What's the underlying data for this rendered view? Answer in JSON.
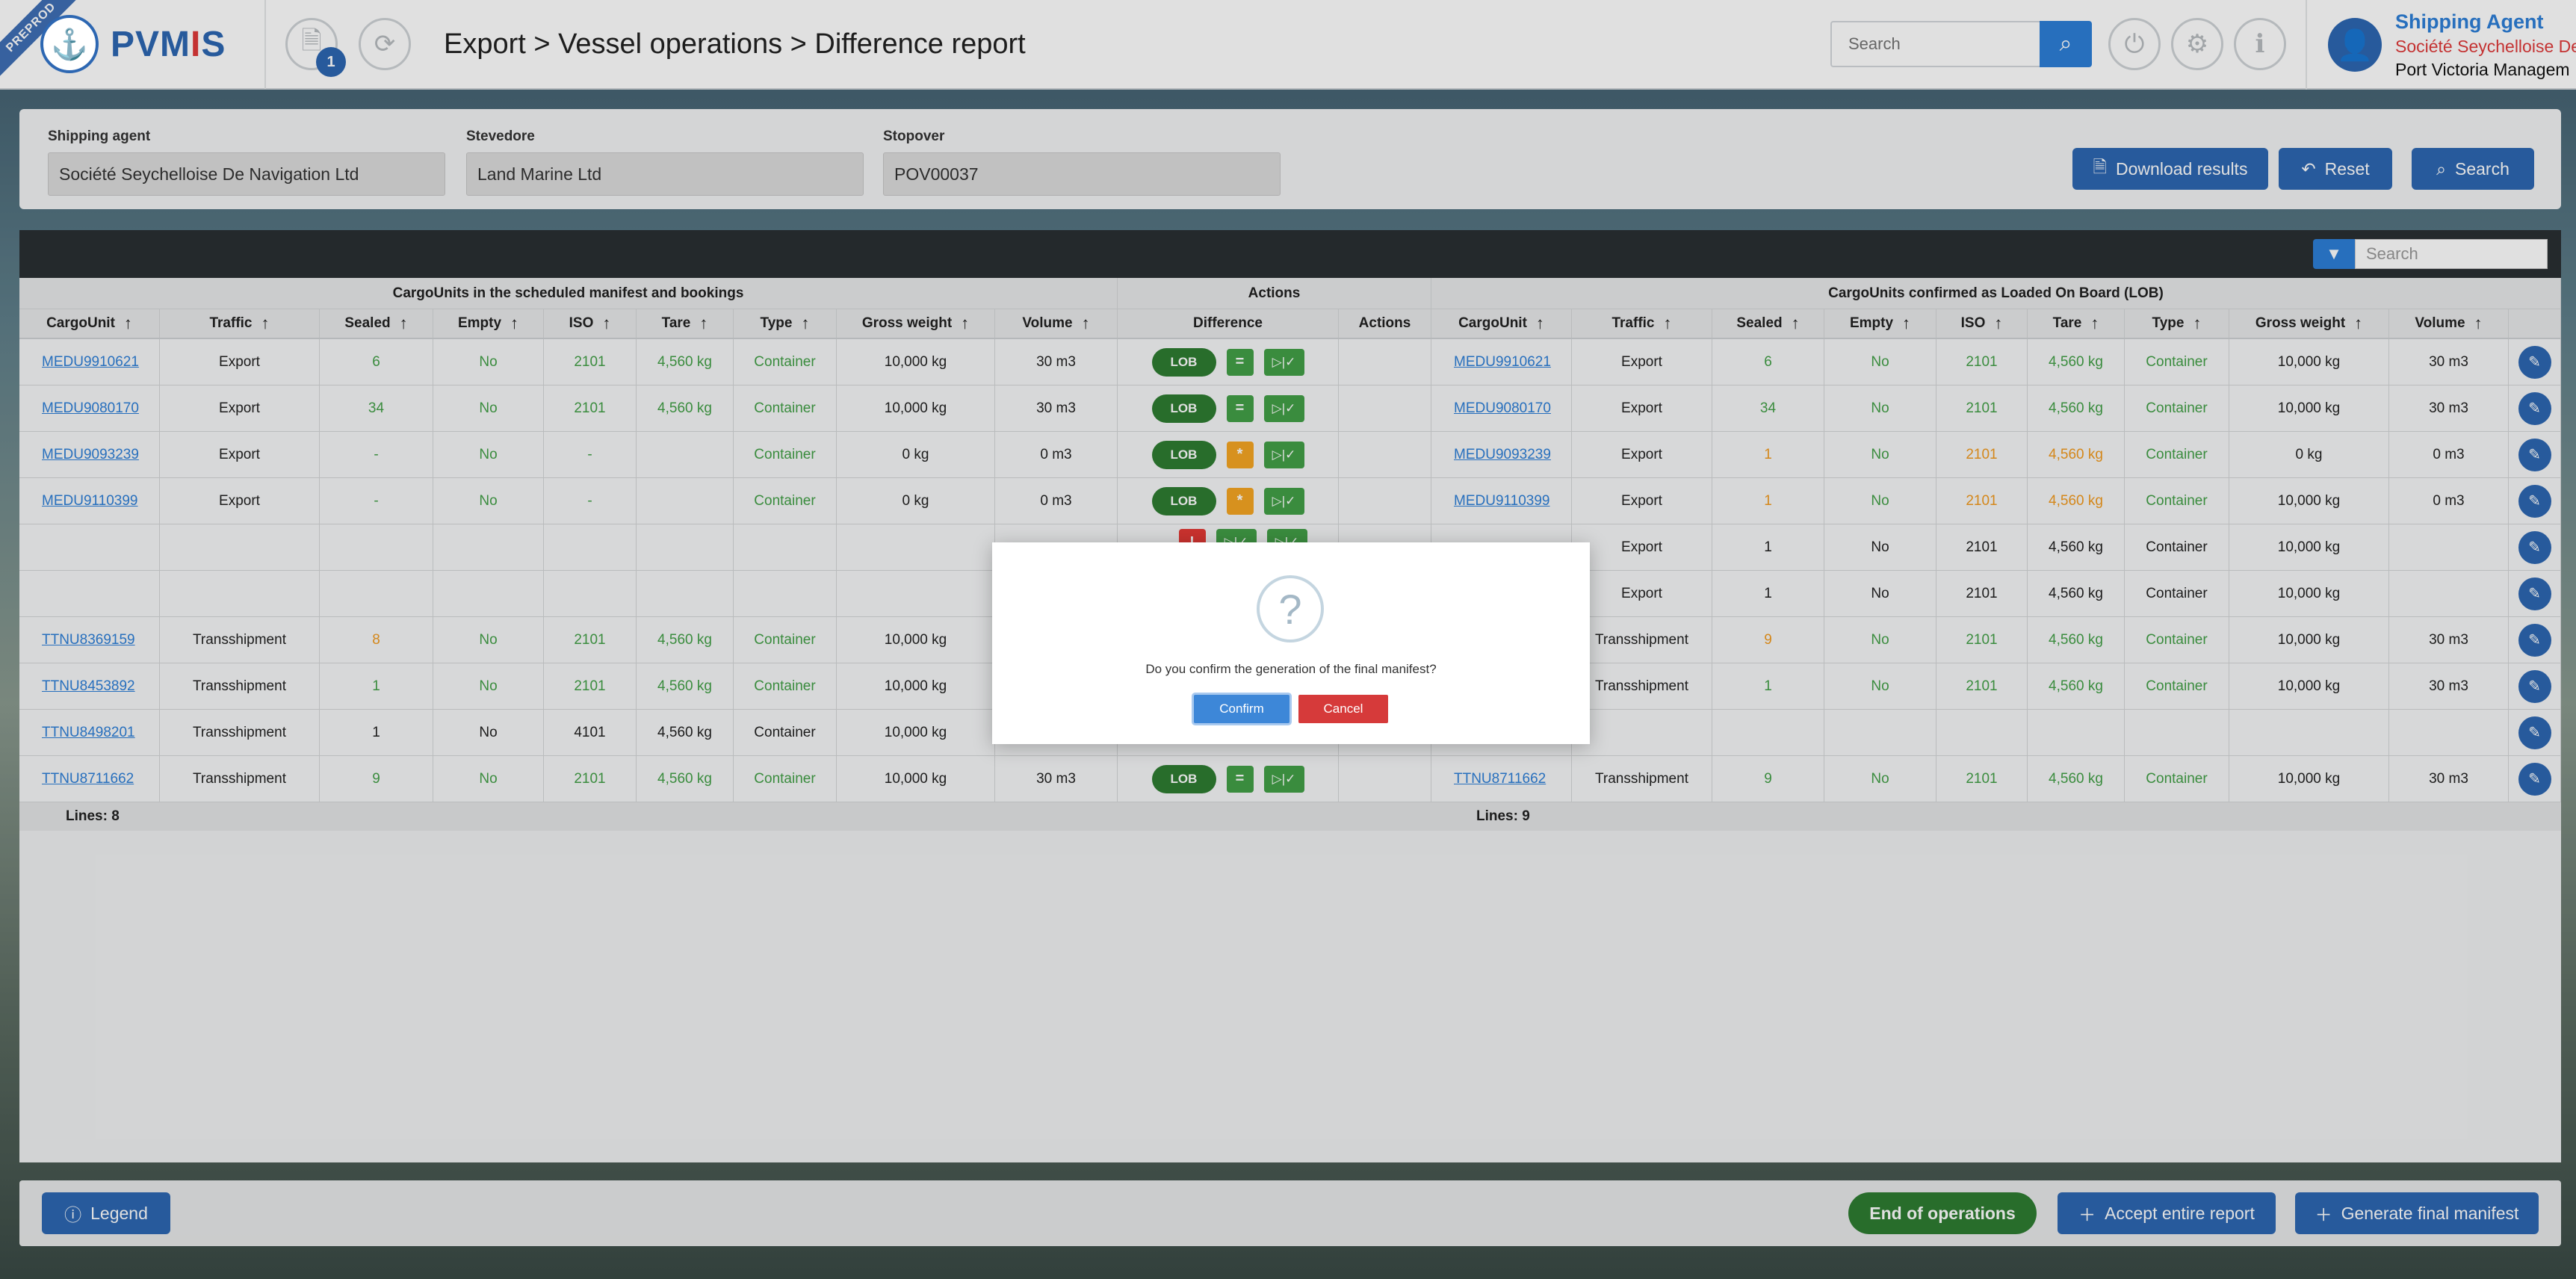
{
  "header": {
    "env_badge": "PREPROD",
    "logo_text_part1": "PVM",
    "logo_text_part2": "I",
    "logo_text_part3": "S",
    "notification_count": "1",
    "breadcrumb": "Export > Vessel operations > Difference report",
    "search_placeholder": "Search",
    "user": {
      "role": "Shipping Agent",
      "org": "Société Seychelloise De",
      "port": "Port Victoria Managem"
    }
  },
  "filters": {
    "shipping_agent_label": "Shipping agent",
    "shipping_agent_value": "Société Seychelloise De Navigation Ltd",
    "stevedore_label": "Stevedore",
    "stevedore_value": "Land Marine Ltd",
    "stopover_label": "Stopover",
    "stopover_value": "POV00037",
    "download_label": "Download results",
    "reset_label": "Reset",
    "search_label": "Search"
  },
  "table": {
    "search_placeholder": "Search",
    "group_left": "CargoUnits in the scheduled manifest and bookings",
    "group_actions": "Actions",
    "group_right": "CargoUnits confirmed as Loaded On Board (LOB)",
    "columns_left": [
      "CargoUnit",
      "Traffic",
      "Sealed",
      "Empty",
      "ISO",
      "Tare",
      "Type",
      "Gross weight",
      "Volume"
    ],
    "col_difference": "Difference",
    "col_actions": "Actions",
    "columns_right": [
      "CargoUnit",
      "Traffic",
      "Sealed",
      "Empty",
      "ISO",
      "Tare",
      "Type",
      "Gross weight",
      "Volume"
    ],
    "lob_label": "LOB",
    "rows": [
      {
        "left": [
          "MEDU9910621",
          "Export",
          "6",
          "No",
          "2101",
          "4,560 kg",
          "Container",
          "10,000 kg",
          "30 m3"
        ],
        "right": [
          "MEDU9910621",
          "Export",
          "6",
          "No",
          "2101",
          "4,560 kg",
          "Container",
          "10,000 kg",
          "30 m3"
        ],
        "diff": "=",
        "status": "green"
      },
      {
        "left": [
          "MEDU9080170",
          "Export",
          "34",
          "No",
          "2101",
          "4,560 kg",
          "Container",
          "10,000 kg",
          "30 m3"
        ],
        "right": [
          "MEDU9080170",
          "Export",
          "34",
          "No",
          "2101",
          "4,560 kg",
          "Container",
          "10,000 kg",
          "30 m3"
        ],
        "diff": "=",
        "status": "green"
      },
      {
        "left": [
          "MEDU9093239",
          "Export",
          "-",
          "No",
          "-",
          "",
          "Container",
          "0 kg",
          "0 m3"
        ],
        "right": [
          "MEDU9093239",
          "Export",
          "1",
          "No",
          "2101",
          "4,560 kg",
          "Container",
          "0 kg",
          "0 m3"
        ],
        "diff": "*",
        "status": "orange"
      },
      {
        "left": [
          "MEDU9110399",
          "Export",
          "-",
          "No",
          "-",
          "",
          "Container",
          "0 kg",
          "0 m3"
        ],
        "right": [
          "MEDU9110399",
          "Export",
          "1",
          "No",
          "2101",
          "4,560 kg",
          "Container",
          "10,000 kg",
          "0 m3"
        ],
        "diff": "*",
        "status": "orange"
      },
      {
        "left": [
          "",
          "",
          "",
          "",
          "",
          "",
          "",
          "",
          ""
        ],
        "right": [
          "",
          "Export",
          "1",
          "No",
          "2101",
          "4,560 kg",
          "Container",
          "10,000 kg",
          ""
        ],
        "diff": "",
        "status": "plain"
      },
      {
        "left": [
          "",
          "",
          "",
          "",
          "",
          "",
          "",
          "",
          ""
        ],
        "right": [
          "",
          "Export",
          "1",
          "No",
          "2101",
          "4,560 kg",
          "Container",
          "10,000 kg",
          ""
        ],
        "diff": "",
        "status": "plain"
      },
      {
        "left": [
          "TTNU8369159",
          "Transshipment",
          "8",
          "No",
          "2101",
          "4,560 kg",
          "Container",
          "10,000 kg",
          ""
        ],
        "right": [
          "",
          "Transshipment",
          "9",
          "No",
          "2101",
          "4,560 kg",
          "Container",
          "10,000 kg",
          "30 m3"
        ],
        "diff": "",
        "status": "mixed"
      },
      {
        "left": [
          "TTNU8453892",
          "Transshipment",
          "1",
          "No",
          "2101",
          "4,560 kg",
          "Container",
          "10,000 kg",
          ""
        ],
        "right": [
          "",
          "Transshipment",
          "1",
          "No",
          "2101",
          "4,560 kg",
          "Container",
          "10,000 kg",
          "30 m3"
        ],
        "diff": "",
        "status": "green"
      },
      {
        "left": [
          "TTNU8498201",
          "Transshipment",
          "1",
          "No",
          "4101",
          "4,560 kg",
          "Container",
          "10,000 kg",
          ""
        ],
        "right": [
          "",
          "",
          "",
          "",
          "",
          "",
          "",
          "",
          ""
        ],
        "diff": "",
        "status": "plain"
      },
      {
        "left": [
          "TTNU8711662",
          "Transshipment",
          "9",
          "No",
          "2101",
          "4,560 kg",
          "Container",
          "10,000 kg",
          "30 m3"
        ],
        "right": [
          "TTNU8711662",
          "Transshipment",
          "9",
          "No",
          "2101",
          "4,560 kg",
          "Container",
          "10,000 kg",
          "30 m3"
        ],
        "diff": "=",
        "status": "green"
      }
    ],
    "lines_left": "Lines: 8",
    "lines_right": "Lines: 9"
  },
  "footer": {
    "legend_label": "Legend",
    "end_operations_label": "End of operations",
    "accept_report_label": "Accept entire report",
    "generate_manifest_label": "Generate final manifest"
  },
  "modal": {
    "message": "Do you confirm the generation of the final manifest?",
    "confirm_label": "Confirm",
    "cancel_label": "Cancel"
  },
  "colors": {
    "primary": "#2d67b2",
    "accent": "#2d7fd8",
    "success": "#43a047",
    "warning": "#f5a623",
    "danger": "#e53935"
  }
}
